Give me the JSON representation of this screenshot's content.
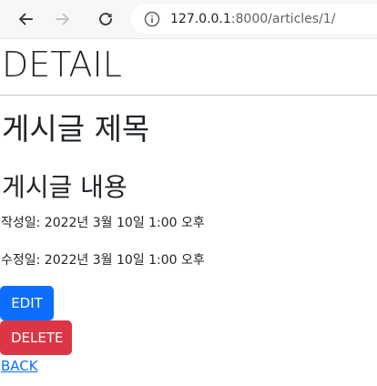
{
  "browser": {
    "url_host": "127.0.0.1",
    "url_rest": ":8000/articles/1/",
    "icons": {
      "back": "arrow-left-icon",
      "forward": "arrow-right-icon",
      "reload": "reload-icon",
      "site_info": "info-icon"
    }
  },
  "page": {
    "heading": "DETAIL",
    "article_title": "게시글 제목",
    "article_content": "게시글 내용",
    "created_at": "작성일: 2022년 3월 10일 1:00 오후",
    "updated_at": "수정일: 2022년 3월 10일 1:00 오후",
    "edit_label": "EDIT",
    "delete_label": "DELETE",
    "back_label": "BACK"
  },
  "colors": {
    "edit_button": "#0d6efd",
    "delete_button": "#dc3545",
    "link": "#0d6efd"
  }
}
